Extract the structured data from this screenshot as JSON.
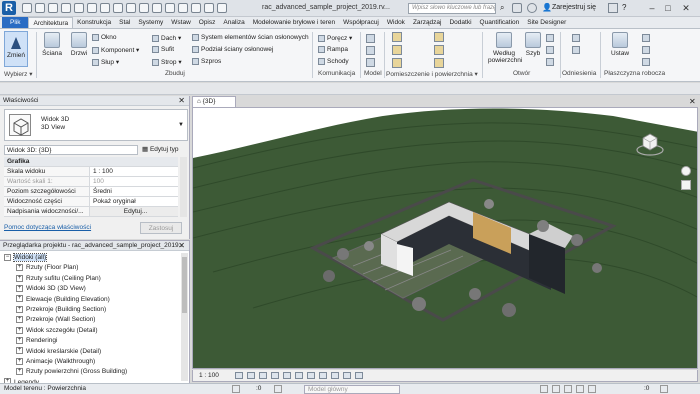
{
  "app": {
    "logo_letter": "R",
    "document_title": "rac_advanced_sample_project_2019.rv...",
    "search_placeholder": "Wpisz słowo kluczowe lub frazę",
    "signin": "Zarejestruj się",
    "accent": "#2a6cc3"
  },
  "tabs": [
    "Plik",
    "Architektura",
    "Konstrukcja",
    "Stal",
    "Systemy",
    "Wstaw",
    "Opisz",
    "Analiza",
    "Modelowanie bryłowe i teren",
    "Współpracuj",
    "Widok",
    "Zarządzaj",
    "Dodatki",
    "Quantification",
    "Site Designer"
  ],
  "active_tab": "Architektura",
  "ribbon": {
    "select": {
      "zmien": "Zmień",
      "wybierz": "Wybierz ▾"
    },
    "build": {
      "sciana": "Ściana",
      "drzwi": "Drzwi",
      "okno": "Okno",
      "komponent": "Komponent ▾",
      "slup": "Słup ▾",
      "dach": "Dach ▾",
      "sufit": "Sufit",
      "strop": "Strop ▾",
      "sys_scian": "System elementów ścian osłonowych",
      "podzial": "Podział ściany osłonowej",
      "sprosy": "Szpros",
      "label": "Zbuduj"
    },
    "circulation": {
      "porecz": "Poręcz ▾",
      "rampa": "Rampa",
      "schody": "Schody",
      "label": "Komunikacja"
    },
    "model": {
      "label": "Model"
    },
    "room": {
      "label": "Pomieszczenie i powierzchnia ▾"
    },
    "opening": {
      "wedlug": "Według",
      "powierzchni": "powierzchni",
      "szyb": "Szyb",
      "label": "Otwór"
    },
    "datum": {
      "label": "Odniesienia"
    },
    "workplane": {
      "ustaw": "Ustaw",
      "label": "Płaszczyzna robocza"
    }
  },
  "properties": {
    "title": "Właściwości",
    "type_line1": "Widok 3D",
    "type_line2": "3D View",
    "instance": "Widok 3D: {3D}",
    "edit_type": "Edytuj typ",
    "group": "Grafika",
    "rows": [
      {
        "k": "Skala widoku",
        "v": "1 : 100",
        "grey": false
      },
      {
        "k": "Wartość skali 1:",
        "v": "100",
        "grey": true
      },
      {
        "k": "Poziom szczegółowości",
        "v": "Średni",
        "grey": false
      },
      {
        "k": "Widoczność części",
        "v": "Pokaż oryginał",
        "grey": false
      },
      {
        "k": "Nadpisania widoczności/...",
        "v": "Edytuj...",
        "grey": false
      }
    ],
    "help_link": "Pomoc dotycząca właściwości",
    "apply": "Zastosuj"
  },
  "browser": {
    "title": "Przeglądarka projektu - rac_advanced_sample_project_2019...",
    "items": [
      {
        "label": "Widoki (all)",
        "depth": 0,
        "sign": "−",
        "selected": true
      },
      {
        "label": "Rzuty (Floor Plan)",
        "depth": 1,
        "sign": "+"
      },
      {
        "label": "Rzuty sufitu (Ceiling Plan)",
        "depth": 1,
        "sign": "+"
      },
      {
        "label": "Widoki 3D (3D View)",
        "depth": 1,
        "sign": "+"
      },
      {
        "label": "Elewacje (Building Elevation)",
        "depth": 1,
        "sign": "+"
      },
      {
        "label": "Przekroje (Building Section)",
        "depth": 1,
        "sign": "+"
      },
      {
        "label": "Przekroje (Wall Section)",
        "depth": 1,
        "sign": "+"
      },
      {
        "label": "Widok szczegółu (Detail)",
        "depth": 1,
        "sign": "+"
      },
      {
        "label": "Renderingi",
        "depth": 1,
        "sign": "+"
      },
      {
        "label": "Widoki kreślarskie (Detail)",
        "depth": 1,
        "sign": "+"
      },
      {
        "label": "Animacje (Walkthrough)",
        "depth": 1,
        "sign": "+"
      },
      {
        "label": "Rzuty powierzchni (Gross Building)",
        "depth": 1,
        "sign": "+"
      },
      {
        "label": "Legendy",
        "depth": 0,
        "sign": "+"
      }
    ]
  },
  "viewport": {
    "tab": "{3D}",
    "scale": "1 : 100",
    "viewcube_label": "FRONT"
  },
  "status": {
    "left": "Model terenu : Powierzchnia",
    "model": "Model główny",
    "zero": ":0"
  }
}
